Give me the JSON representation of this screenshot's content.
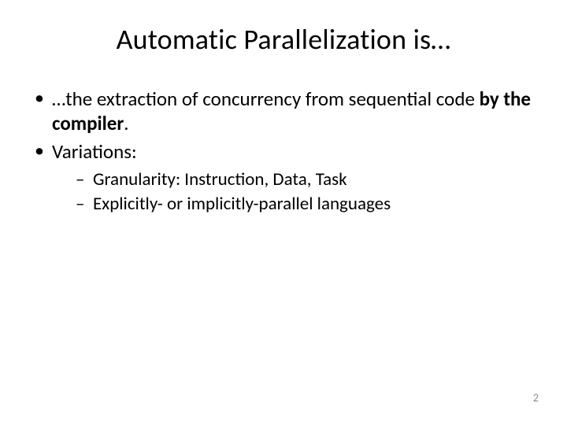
{
  "title": "Automatic Parallelization is…",
  "bullets": {
    "item1_pre": "…the extraction of concurrency from sequential code ",
    "item1_bold": "by the compiler",
    "item1_post": ".",
    "item2": "Variations:"
  },
  "sub": {
    "s1": "Granularity: Instruction, Data, Task",
    "s2": "Explicitly- or implicitly-parallel languages"
  },
  "page_number": "2"
}
